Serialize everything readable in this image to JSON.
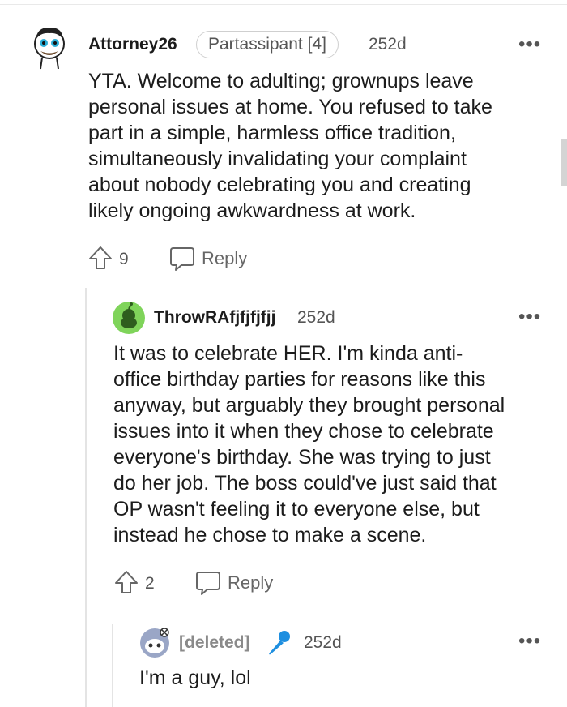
{
  "comments": [
    {
      "author": "Attorney26",
      "flair": "Partassipant [4]",
      "age": "252d",
      "more": "•••",
      "body": "YTA. Welcome to adulting; grownups leave\npersonal issues at home. You refused to take\npart in a simple, harmless office tradition,\nsimultaneously invalidating your complaint\nabout nobody celebrating you and creating\nlikely ongoing awkwardness at work.",
      "upvotes": "9",
      "reply_label": "Reply"
    },
    {
      "author": "ThrowRAfjfjfjfjj",
      "age": "252d",
      "more": "•••",
      "body": "It was to celebrate HER. I'm kinda anti-\noffice birthday parties for reasons like this\nanyway, but arguably they brought personal\nissues into it when they chose to celebrate\neveryone's birthday. She was trying to just\ndo her job. The boss could've just said that\nOP wasn't feeling it to everyone else, but\ninstead he chose to make a scene.",
      "upvotes": "2",
      "reply_label": "Reply"
    },
    {
      "author": "[deleted]",
      "age": "252d",
      "more": "•••",
      "body": "I'm a guy, lol"
    }
  ],
  "colors": {
    "mic": "#1e8fe0",
    "avatar_green": "#7fd45a"
  }
}
